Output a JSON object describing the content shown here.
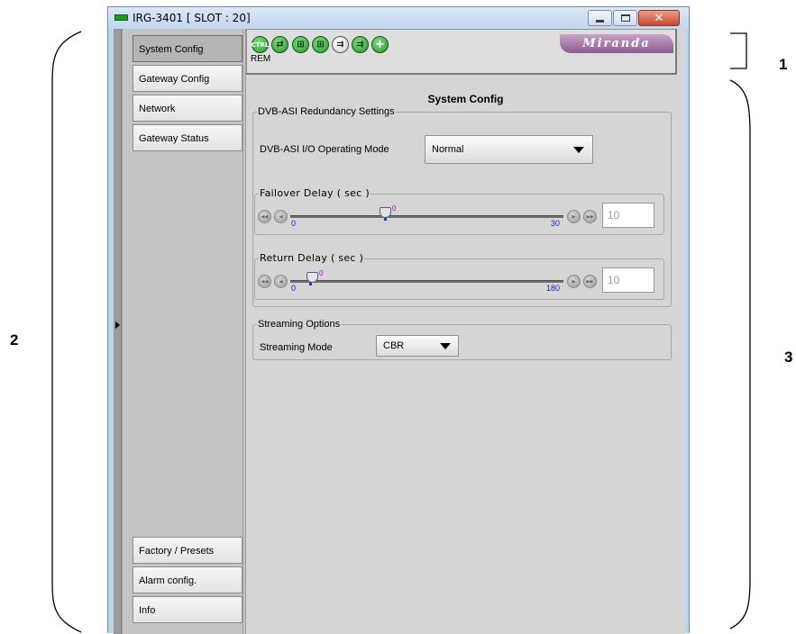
{
  "callouts": {
    "one": "1",
    "two": "2",
    "three": "3"
  },
  "window": {
    "title": "IRG-3401 [ SLOT : 20]",
    "buttons": {
      "minimize": "minimize-icon",
      "maximize": "maximize-icon",
      "close": "close-icon",
      "close_glyph": "✕"
    }
  },
  "sidebar": {
    "top_items": [
      {
        "label": "System Config",
        "active": true
      },
      {
        "label": "Gateway Config"
      },
      {
        "label": "Network"
      },
      {
        "label": "Gateway Status"
      }
    ],
    "bottom_items": [
      {
        "label": "Factory / Presets"
      },
      {
        "label": "Alarm config."
      },
      {
        "label": "Info"
      }
    ]
  },
  "status_bar": {
    "ctrl_label": "CTRL",
    "rem_label": "REM",
    "logo_text": "Miranda",
    "icons": [
      "ctrl-icon",
      "signal-icon",
      "network-icon",
      "network-icon",
      "input-icon",
      "output-icon",
      "add-icon"
    ],
    "colors": {
      "icon_green": "#2e9e33",
      "logo_purple": "#9a6a9a"
    }
  },
  "main": {
    "title": "System Config",
    "dvb_asi": {
      "legend": "DVB-ASI Redundancy Settings",
      "mode_label": "DVB-ASI I/O Operating Mode",
      "mode_value": "Normal",
      "failover": {
        "legend": "Failover Delay ( sec )",
        "min": "0",
        "max": "30",
        "value": "0",
        "input_value": "10"
      },
      "return_delay": {
        "legend": "Return Delay ( sec )",
        "min": "0",
        "max": "180",
        "value": "0",
        "input_value": "10"
      }
    },
    "streaming": {
      "legend": "Streaming Options",
      "mode_label": "Streaming Mode",
      "mode_value": "CBR"
    }
  }
}
